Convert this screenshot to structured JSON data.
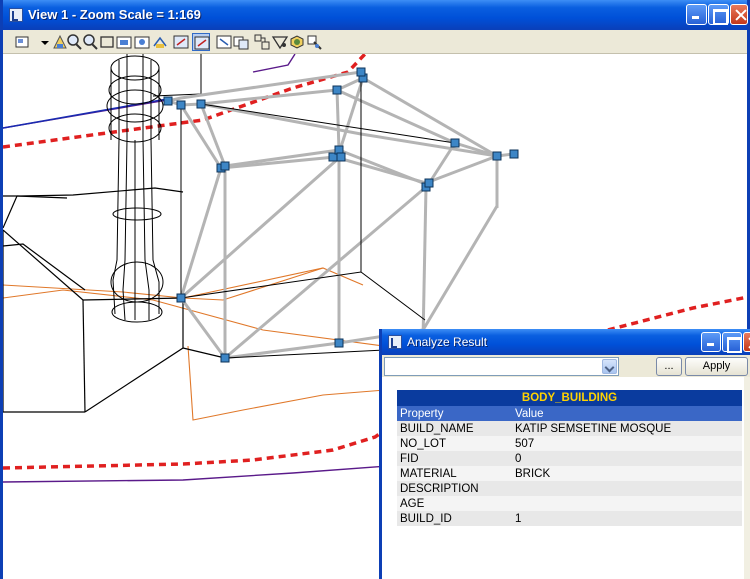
{
  "view_window": {
    "title": "View 1 - Zoom Scale = 1:169",
    "toolbar_icons": [
      "view-display-icon",
      "dropdown-arrow-icon",
      "update-view-icon",
      "zoom-in-icon",
      "zoom-out-icon",
      "window-area-icon",
      "fit-view-icon",
      "fit-all-icon",
      "rotate-view-icon",
      "pan-view-icon",
      "view-previous-icon",
      "view-next-icon",
      "copy-view-icon",
      "clip-volume-icon",
      "render-icon",
      "camera-icon",
      "view-attributes-icon"
    ],
    "active_tool_index": 10
  },
  "dialog": {
    "title": "Analyze Result",
    "combo_value": "",
    "browse_label": "...",
    "apply_label": "Apply",
    "table": {
      "caption": "BODY_BUILDING",
      "headers": [
        "Property",
        "Value"
      ],
      "rows": [
        [
          "BUILD_NAME",
          "KATIP SEMSETINE MOSQUE"
        ],
        [
          "NO_LOT",
          "507"
        ],
        [
          "FID",
          "0"
        ],
        [
          "MATERIAL",
          "BRICK"
        ],
        [
          "DESCRIPTION",
          ""
        ],
        [
          "AGE",
          ""
        ],
        [
          "BUILD_ID",
          "1"
        ]
      ]
    }
  },
  "colors": {
    "titlebar": "#0050d8",
    "parcel_boundary": "#e02020",
    "wireframe_selected": "#b4b4b4",
    "handle": "#3d86c6",
    "orange_lines": "#e0782a",
    "road_lines": "#5a1a8a"
  }
}
